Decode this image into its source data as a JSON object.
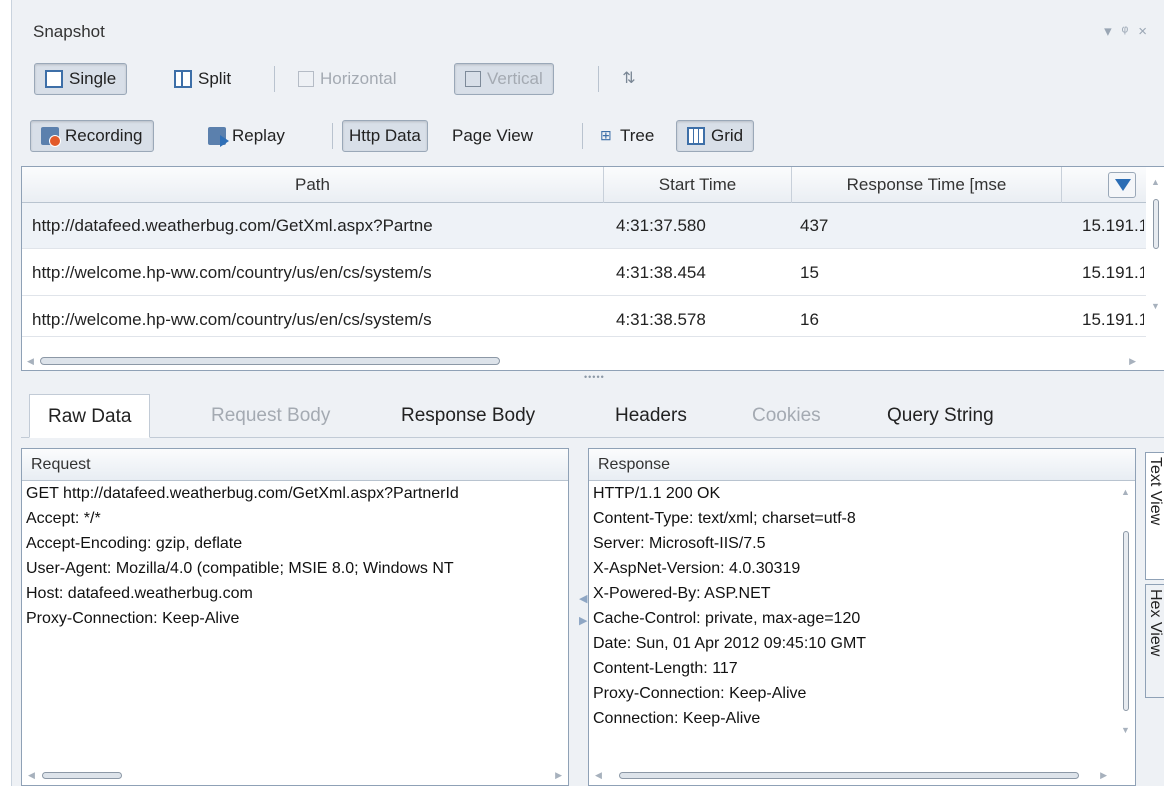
{
  "title": "Snapshot",
  "window_controls": [
    "▾",
    "ᵠ",
    "×"
  ],
  "toolbar1": {
    "single": "Single",
    "split": "Split",
    "horizontal": "Horizontal",
    "vertical": "Vertical"
  },
  "toolbar2": {
    "recording": "Recording",
    "replay": "Replay",
    "http_data": "Http Data",
    "page_view": "Page View",
    "tree": "Tree",
    "grid": "Grid"
  },
  "grid": {
    "columns": [
      "Path",
      "Start Time",
      "Response Time [mse",
      ""
    ],
    "rows": [
      {
        "path": "http://datafeed.weatherbug.com/GetXml.aspx?Partne",
        "start": "4:31:37.580",
        "resp": "437",
        "ip": "15.191.1"
      },
      {
        "path": "http://welcome.hp-ww.com/country/us/en/cs/system/s",
        "start": "4:31:38.454",
        "resp": "15",
        "ip": "15.191.1"
      },
      {
        "path": "http://welcome.hp-ww.com/country/us/en/cs/system/s",
        "start": "4:31:38.578",
        "resp": "16",
        "ip": "15.191.1"
      }
    ]
  },
  "tabs": {
    "raw_data": "Raw Data",
    "request_body": "Request Body",
    "response_body": "Response Body",
    "headers": "Headers",
    "cookies": "Cookies",
    "query_string": "Query String"
  },
  "request": {
    "header": "Request",
    "lines": [
      "GET http://datafeed.weatherbug.com/GetXml.aspx?PartnerId",
      "Accept: */*",
      "Accept-Encoding: gzip, deflate",
      "User-Agent: Mozilla/4.0 (compatible; MSIE 8.0; Windows NT",
      "Host: datafeed.weatherbug.com",
      "Proxy-Connection: Keep-Alive"
    ]
  },
  "response": {
    "header": "Response",
    "lines": [
      "HTTP/1.1 200 OK",
      "Content-Type: text/xml; charset=utf-8",
      "Server: Microsoft-IIS/7.5",
      "X-AspNet-Version: 4.0.30319",
      "X-Powered-By: ASP.NET",
      "Cache-Control: private, max-age=120",
      "Date: Sun, 01 Apr 2012 09:45:10 GMT",
      "Content-Length: 117",
      "Proxy-Connection: Keep-Alive",
      "Connection: Keep-Alive"
    ]
  },
  "side_tabs": {
    "text_view": "Text View",
    "hex_view": "Hex View"
  }
}
